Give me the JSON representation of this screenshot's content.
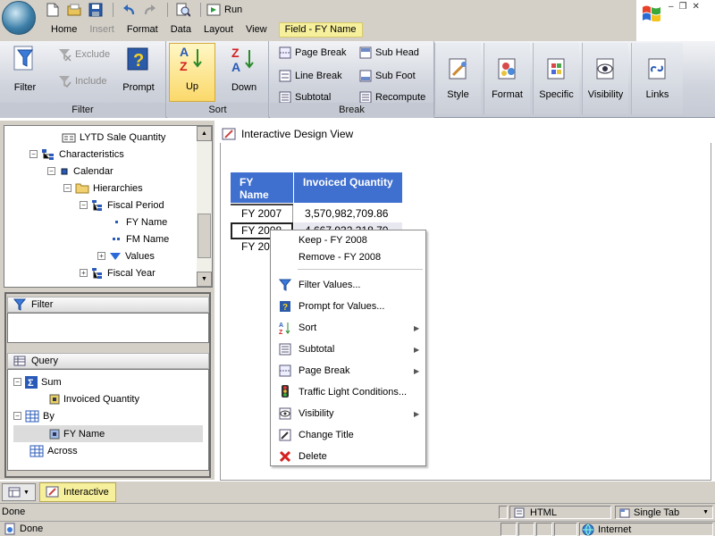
{
  "quick_access": {
    "run_label": "Run"
  },
  "menu": {
    "items": [
      {
        "label": "Home",
        "enabled": true
      },
      {
        "label": "Insert",
        "enabled": false
      },
      {
        "label": "Format",
        "enabled": true
      },
      {
        "label": "Data",
        "enabled": true
      },
      {
        "label": "Layout",
        "enabled": true
      },
      {
        "label": "View",
        "enabled": true
      }
    ],
    "context_tab": "Field - FY Name"
  },
  "ribbon": {
    "filter_group": {
      "caption": "Filter",
      "filter_label": "Filter",
      "exclude_label": "Exclude",
      "include_label": "Include",
      "prompt_label": "Prompt"
    },
    "sort_group": {
      "caption": "Sort",
      "up_label": "Up",
      "down_label": "Down"
    },
    "break_group": {
      "caption": "Break",
      "page_break": "Page Break",
      "sub_head": "Sub Head",
      "line_break": "Line Break",
      "sub_foot": "Sub Foot",
      "subtotal": "Subtotal",
      "recompute": "Recompute"
    },
    "right_buttons": [
      "Style",
      "Format",
      "Specific",
      "Visibility",
      "Links"
    ]
  },
  "tree": {
    "rows": [
      {
        "label": "LYTD Sale Quantity",
        "icon": "measure-icon"
      },
      {
        "label": "Characteristics",
        "icon": "hierarchy-icon"
      },
      {
        "label": "Calendar",
        "icon": "dimension-icon"
      },
      {
        "label": "Hierarchies",
        "icon": "folder-icon"
      },
      {
        "label": "Fiscal Period",
        "icon": "hierarchy-level-icon"
      },
      {
        "label": "FY Name",
        "icon": "attribute-dot-icon"
      },
      {
        "label": "FM Name",
        "icon": "attribute-dots-icon"
      },
      {
        "label": "Values",
        "icon": "values-triangle-icon"
      },
      {
        "label": "Fiscal Year",
        "icon": "hierarchy-level-icon"
      }
    ]
  },
  "filter_panel": {
    "title": "Filter"
  },
  "query_panel": {
    "title": "Query",
    "sum_label": "Sum",
    "sum_field": "Invoiced Quantity",
    "by_label": "By",
    "by_field": "FY Name",
    "across_label": "Across"
  },
  "design_view": {
    "title": "Interactive Design View",
    "columns": [
      "FY Name",
      "Invoiced Quantity"
    ],
    "rows": [
      {
        "name": "FY 2007",
        "value": "3,570,982,709.86"
      },
      {
        "name": "FY 2008",
        "value": "4,667,932,318.70"
      },
      {
        "name": "FY 20",
        "value": ""
      }
    ]
  },
  "context_menu": {
    "items": [
      {
        "label": "Keep - FY 2008",
        "icon": "",
        "submenu": false
      },
      {
        "label": "Remove - FY 2008",
        "icon": "",
        "submenu": false
      },
      {
        "label": "Filter Values...",
        "icon": "filter-funnel-icon",
        "submenu": false
      },
      {
        "label": "Prompt for Values...",
        "icon": "prompt-icon",
        "submenu": false
      },
      {
        "label": "Sort",
        "icon": "sort-az-icon",
        "submenu": true
      },
      {
        "label": "Subtotal",
        "icon": "subtotal-icon",
        "submenu": true
      },
      {
        "label": "Page Break",
        "icon": "page-break-icon",
        "submenu": true
      },
      {
        "label": "Traffic Light Conditions...",
        "icon": "traffic-light-icon",
        "submenu": false
      },
      {
        "label": "Visibility",
        "icon": "visibility-icon",
        "submenu": true
      },
      {
        "label": "Change Title",
        "icon": "change-title-icon",
        "submenu": false
      },
      {
        "label": "Delete",
        "icon": "delete-x-icon",
        "submenu": false
      }
    ]
  },
  "bottom_tab": {
    "label": "Interactive"
  },
  "status": {
    "left": "Done",
    "format": "HTML",
    "tab_mode": "Single Tab",
    "browser_left": "Done",
    "zone": "Internet"
  },
  "colors": {
    "header_blue": "#3f6fcf",
    "tab_yellow": "#f6ef9c",
    "delete_red": "#d42020"
  }
}
